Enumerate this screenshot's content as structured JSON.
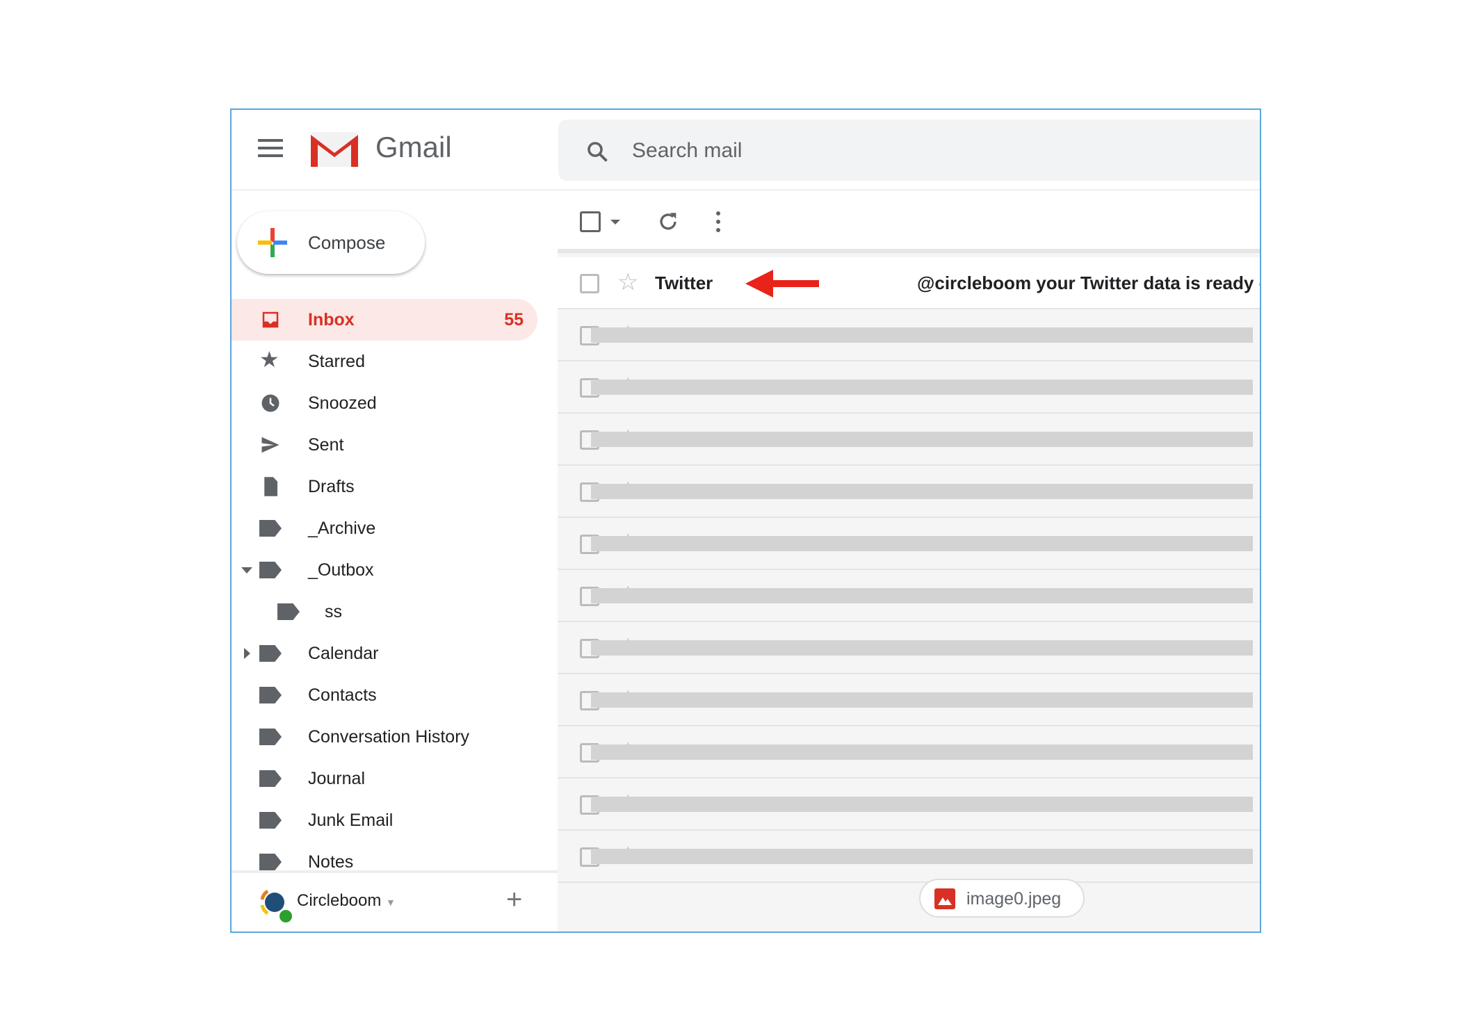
{
  "app": {
    "brand": "Gmail",
    "search_placeholder": "Search mail"
  },
  "compose": {
    "label": "Compose"
  },
  "sidebar": {
    "items": [
      {
        "label": "Inbox",
        "count": "55",
        "icon": "inbox-icon",
        "active": true
      },
      {
        "label": "Starred",
        "icon": "star-icon"
      },
      {
        "label": "Snoozed",
        "icon": "clock-icon"
      },
      {
        "label": "Sent",
        "icon": "send-icon"
      },
      {
        "label": "Drafts",
        "icon": "draft-icon"
      },
      {
        "label": "_Archive",
        "icon": "label-icon"
      },
      {
        "label": "_Outbox",
        "icon": "label-icon",
        "expanded": true
      },
      {
        "label": "ss",
        "icon": "label-icon",
        "nested": true
      },
      {
        "label": "Calendar",
        "icon": "label-icon",
        "collapsed": true
      },
      {
        "label": "Contacts",
        "icon": "label-icon"
      },
      {
        "label": "Conversation History",
        "icon": "label-icon"
      },
      {
        "label": "Journal",
        "icon": "label-icon"
      },
      {
        "label": "Junk Email",
        "icon": "label-icon"
      },
      {
        "label": "Notes",
        "icon": "label-icon"
      }
    ]
  },
  "account": {
    "name": "Circleboom"
  },
  "emails": [
    {
      "sender": "Twitter",
      "subject": "@circleboom your Twitter data is ready -",
      "unread": true,
      "redacted": false
    }
  ],
  "redacted_rows": 11,
  "attachment": {
    "name": "image0.jpeg"
  },
  "colors": {
    "accent": "#d93025",
    "frame": "#5aa7e0",
    "arrow": "#e8231a"
  }
}
